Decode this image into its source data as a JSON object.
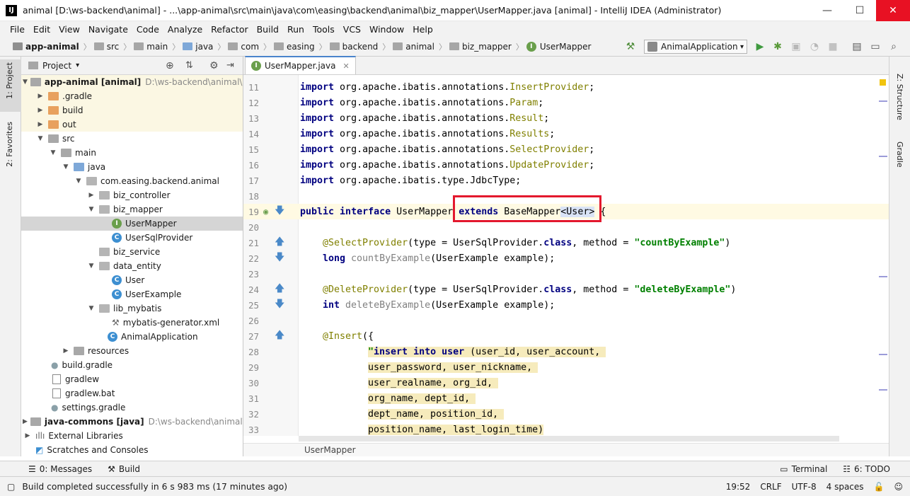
{
  "window": {
    "title": "animal [D:\\ws-backend\\animal] - ...\\app-animal\\src\\main\\java\\com\\easing\\backend\\animal\\biz_mapper\\UserMapper.java [animal] - IntelliJ IDEA (Administrator)",
    "app_icon": "IJ",
    "minimize": "—",
    "maximize": "☐",
    "close": "✕"
  },
  "menu": [
    "File",
    "Edit",
    "View",
    "Navigate",
    "Code",
    "Analyze",
    "Refactor",
    "Build",
    "Run",
    "Tools",
    "VCS",
    "Window",
    "Help"
  ],
  "breadcrumb": {
    "items": [
      "app-animal",
      "src",
      "main",
      "java",
      "com",
      "easing",
      "backend",
      "animal",
      "biz_mapper"
    ],
    "file_badge": "I",
    "file": "UserMapper"
  },
  "toolbar": {
    "run_config": "AnimalApplication",
    "icons": [
      "hammer-icon",
      "run-icon",
      "debug-icon",
      "coverage-icon",
      "profile-icon",
      "stop-icon",
      "project-structure-icon",
      "terminal-icon",
      "search-icon"
    ]
  },
  "left_strip": {
    "project": "1: Project",
    "favorites": "2: Favorites"
  },
  "right_strip": {
    "structure": "Z: Structure",
    "gradle": "Gradle"
  },
  "project_panel": {
    "title": "Project",
    "tree": [
      {
        "label": "app-animal [animal]",
        "path": "D:\\ws-backend\\animal\\app-a",
        "bold": true
      },
      {
        "label": ".gradle"
      },
      {
        "label": "build"
      },
      {
        "label": "out"
      },
      {
        "label": "src"
      },
      {
        "label": "main"
      },
      {
        "label": "java"
      },
      {
        "label": "com.easing.backend.animal"
      },
      {
        "label": "biz_controller"
      },
      {
        "label": "biz_mapper"
      },
      {
        "label": "UserMapper",
        "badge": "I"
      },
      {
        "label": "UserSqlProvider",
        "badge": "C"
      },
      {
        "label": "biz_service"
      },
      {
        "label": "data_entity"
      },
      {
        "label": "User",
        "badge": "C"
      },
      {
        "label": "UserExample",
        "badge": "C"
      },
      {
        "label": "lib_mybatis"
      },
      {
        "label": "mybatis-generator.xml"
      },
      {
        "label": "AnimalApplication",
        "badge": "C"
      },
      {
        "label": "resources"
      },
      {
        "label": "build.gradle"
      },
      {
        "label": "gradlew"
      },
      {
        "label": "gradlew.bat"
      },
      {
        "label": "settings.gradle"
      },
      {
        "label": "java-commons [java]",
        "path": "D:\\ws-backend\\animal\\java-c",
        "bold": true
      },
      {
        "label": "External Libraries"
      },
      {
        "label": "Scratches and Consoles"
      }
    ]
  },
  "editor": {
    "tab": "UserMapper.java",
    "tab_badge": "I",
    "bottom_breadcrumb": "UserMapper",
    "lines": {
      "n": [
        "11",
        "12",
        "13",
        "14",
        "15",
        "16",
        "17",
        "18",
        "19",
        "20",
        "21",
        "22",
        "23",
        "24",
        "25",
        "26",
        "27",
        "28",
        "29",
        "30",
        "31",
        "32",
        "33"
      ],
      "l11": {
        "kw": "import",
        "pkg": " org.apache.ibatis.annotations.",
        "name": "InsertProvider",
        "end": ";"
      },
      "l12": {
        "kw": "import",
        "pkg": " org.apache.ibatis.annotations.",
        "name": "Param",
        "end": ";"
      },
      "l13": {
        "kw": "import",
        "pkg": " org.apache.ibatis.annotations.",
        "name": "Result",
        "end": ";"
      },
      "l14": {
        "kw": "import",
        "pkg": " org.apache.ibatis.annotations.",
        "name": "Results",
        "end": ";"
      },
      "l15": {
        "kw": "import",
        "pkg": " org.apache.ibatis.annotations.",
        "name": "SelectProvider",
        "end": ";"
      },
      "l16": {
        "kw": "import",
        "pkg": " org.apache.ibatis.annotations.",
        "name": "UpdateProvider",
        "end": ";"
      },
      "l17": {
        "kw": "import",
        "pkg": " org.apache.ibatis.type.JdbcType;"
      },
      "l19": {
        "kw1": "public",
        "kw2": " interface",
        "name": " UserMapper ",
        "kw3": "extends",
        "base": " BaseMapper",
        "generic": "<User>",
        "end": " {"
      },
      "l21": {
        "ann": "@SelectProvider",
        "p1": "(type = UserSqlProvider.",
        "kw": "class",
        "p2": ", method = ",
        "str": "\"countByExample\"",
        "end": ")"
      },
      "l22": {
        "kw": "long",
        "name": " countByExample",
        "rest": "(UserExample example);"
      },
      "l24": {
        "ann": "@DeleteProvider",
        "p1": "(type = UserSqlProvider.",
        "kw": "class",
        "p2": ", method = ",
        "str": "\"deleteByExample\"",
        "end": ")"
      },
      "l25": {
        "kw": "int",
        "name": " deleteByExample",
        "rest": "(UserExample example);"
      },
      "l27": {
        "ann": "@Insert",
        "rest": "({"
      },
      "l28": {
        "q": "\"",
        "kw1": "insert",
        "kw2": " into",
        "kw3": " user",
        "rest": " (user_id, user_account, "
      },
      "l29": "user_password, user_nickname, ",
      "l30": "user_realname, org_id, ",
      "l31": "org_name, dept_id, ",
      "l32": "dept_name, position_id, ",
      "l33": "position_name, last_login_time)"
    }
  },
  "bottom_tools": {
    "messages": "0: Messages",
    "build": "Build",
    "terminal": "Terminal",
    "todo": "6: TODO"
  },
  "status": {
    "message": "Build completed successfully in 6 s 983 ms (17 minutes ago)",
    "position": "19:52",
    "line_sep": "CRLF",
    "encoding": "UTF-8",
    "indent": "4 spaces"
  }
}
